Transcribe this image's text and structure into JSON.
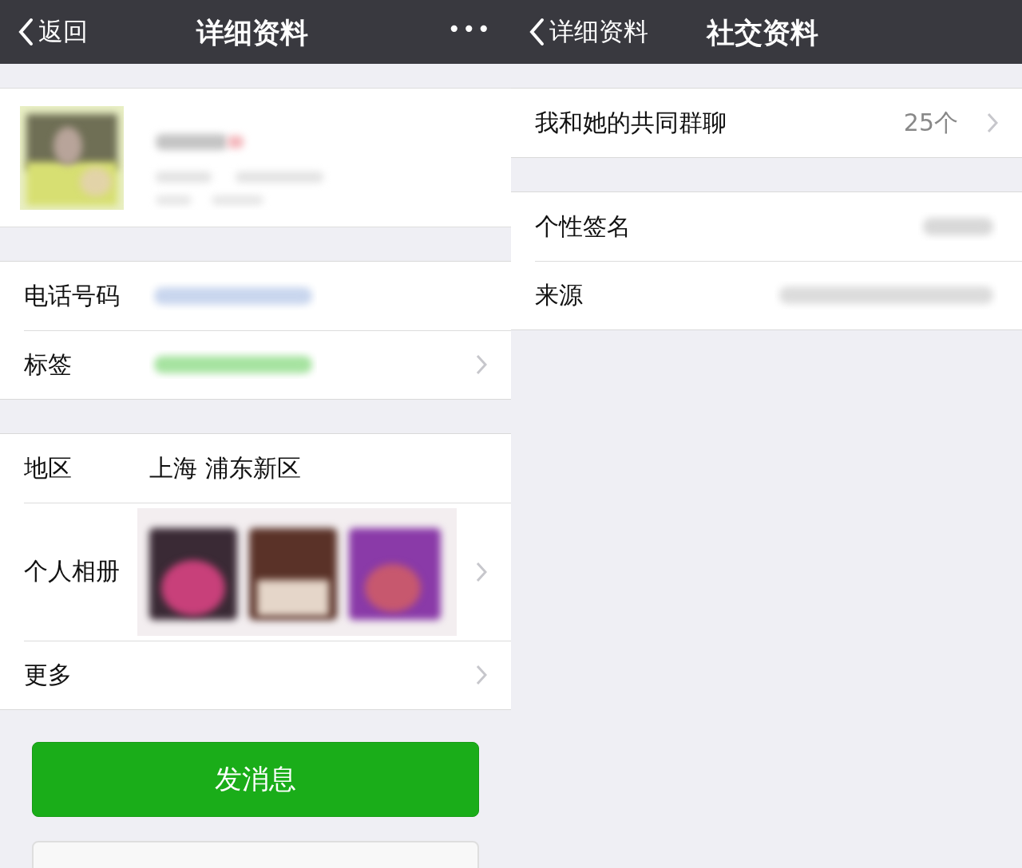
{
  "left_pane": {
    "nav": {
      "back": "返回",
      "title": "详细资料",
      "more": "•••"
    },
    "groups": [
      [
        {
          "label": "电话号码",
          "kind": "blurred",
          "chevron": false
        },
        {
          "label": "标签",
          "kind": "blurred",
          "chevron": true
        }
      ],
      [
        {
          "label": "地区",
          "kind": "text",
          "value": "上海 浦东新区",
          "chevron": false
        },
        {
          "label": "个人相册",
          "kind": "album",
          "chevron": true
        },
        {
          "label": "更多",
          "kind": "text",
          "chevron": true
        }
      ]
    ],
    "buttons": [
      {
        "label": "发消息",
        "kind": "primary"
      }
    ]
  },
  "right_pane": {
    "nav": {
      "back": "详细资料",
      "title": "社交资料"
    },
    "groups": [
      [
        {
          "label": "我和她的共同群聊",
          "kind": "text",
          "value": "25个",
          "chevron": true
        }
      ],
      [
        {
          "label": "个性签名",
          "kind": "blurred",
          "chevron": false
        },
        {
          "label": "来源",
          "kind": "blurred",
          "chevron": false
        }
      ]
    ]
  }
}
